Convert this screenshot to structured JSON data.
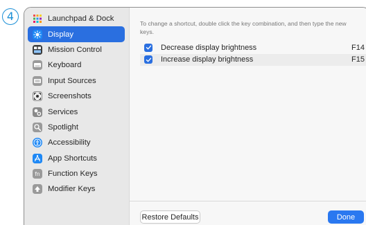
{
  "step_number": "4",
  "sidebar": {
    "items": [
      {
        "label": "Launchpad & Dock",
        "icon": "launchpad-icon",
        "icon_color": "#e8e8e8",
        "selected": false
      },
      {
        "label": "Display",
        "icon": "display-brightness-icon",
        "icon_color": "#1e88f5",
        "selected": true
      },
      {
        "label": "Mission Control",
        "icon": "mission-control-icon",
        "icon_color": "#3a3a3a",
        "selected": false
      },
      {
        "label": "Keyboard",
        "icon": "keyboard-icon",
        "icon_color": "#9a9a9a",
        "selected": false
      },
      {
        "label": "Input Sources",
        "icon": "input-sources-icon",
        "icon_color": "#9a9a9a",
        "selected": false
      },
      {
        "label": "Screenshots",
        "icon": "screenshot-icon",
        "icon_color": "#7a7a7a",
        "selected": false
      },
      {
        "label": "Services",
        "icon": "services-icon",
        "icon_color": "#8a8a8a",
        "selected": false
      },
      {
        "label": "Spotlight",
        "icon": "spotlight-icon",
        "icon_color": "#9a9a9a",
        "selected": false
      },
      {
        "label": "Accessibility",
        "icon": "accessibility-icon",
        "icon_color": "#1e88f5",
        "selected": false
      },
      {
        "label": "App Shortcuts",
        "icon": "app-store-icon",
        "icon_color": "#1e88f5",
        "selected": false
      },
      {
        "label": "Function Keys",
        "icon": "fn-key-icon",
        "icon_color": "#9a9a9a",
        "selected": false
      },
      {
        "label": "Modifier Keys",
        "icon": "modifier-key-icon",
        "icon_color": "#9a9a9a",
        "selected": false
      }
    ]
  },
  "main": {
    "hint": "To change a shortcut, double click the key combination, and then type the new keys.",
    "shortcuts": [
      {
        "label": "Decrease display brightness",
        "key": "F14",
        "checked": true
      },
      {
        "label": "Increase display brightness",
        "key": "F15",
        "checked": true
      }
    ]
  },
  "footer": {
    "restore_label": "Restore Defaults",
    "done_label": "Done"
  },
  "colors": {
    "accent": "#2a6fe0",
    "badge": "#1b8fd6"
  }
}
